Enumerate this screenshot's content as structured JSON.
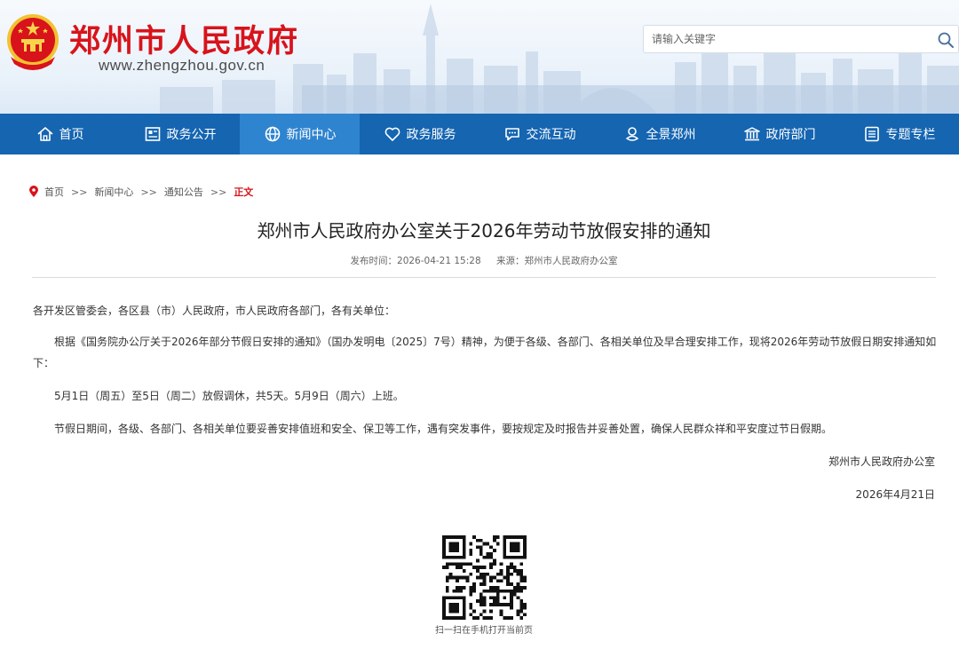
{
  "header": {
    "site_title": "郑州市人民政府",
    "site_url": "www.zhengzhou.gov.cn",
    "search": {
      "placeholder": "请输入关键字"
    },
    "colors": {
      "title_red": "#d8131b",
      "nav_blue": "#1565b1",
      "nav_active": "#2f84cf"
    }
  },
  "nav": {
    "items": [
      {
        "label": "首页",
        "icon": "home-icon"
      },
      {
        "label": "政务公开",
        "icon": "document-icon"
      },
      {
        "label": "新闻中心",
        "icon": "globe-icon",
        "active": true
      },
      {
        "label": "政务服务",
        "icon": "heart-icon"
      },
      {
        "label": "交流互动",
        "icon": "chat-icon"
      },
      {
        "label": "全景郑州",
        "icon": "panorama-icon"
      },
      {
        "label": "政府部门",
        "icon": "building-icon"
      },
      {
        "label": "专题专栏",
        "icon": "list-icon"
      }
    ]
  },
  "breadcrumb": {
    "items": [
      "首页",
      "新闻中心",
      "通知公告"
    ],
    "separator": ">>",
    "current": "正文"
  },
  "article": {
    "title": "郑州市人民政府办公室关于2026年劳动节放假安排的通知",
    "publish_time": "发布时间：2026-04-21 15:28",
    "source": "来源：郑州市人民政府办公室",
    "paragraphs": [
      "各开发区管委会，各区县（市）人民政府，市人民政府各部门，各有关单位：",
      "根据《国务院办公厅关于2026年部分节假日安排的通知》（国办发明电〔2025〕7号）精神，为便于各级、各部门、各相关单位及早合理安排工作，现将2026年劳动节放假日期安排通知如下：",
      "5月1日（周五）至5日（周二）放假调休，共5天。5月9日（周六）上班。",
      "节假日期间，各级、各部门、各相关单位要妥善安排值班和安全、保卫等工作，遇有突发事件，要按规定及时报告并妥善处置，确保人民群众祥和平安度过节日假期。"
    ],
    "signature": "郑州市人民政府办公室",
    "date": "2026年4月21日"
  },
  "qr": {
    "caption": "扫一扫在手机打开当前页"
  }
}
